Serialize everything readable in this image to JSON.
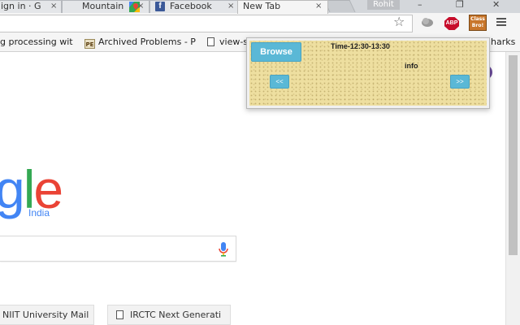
{
  "tabs": [
    {
      "label": "ign in · G",
      "close": "×"
    },
    {
      "label": "Mountain",
      "close": "×"
    },
    {
      "label": "Facebook",
      "close": "×"
    },
    {
      "label": "New Tab",
      "close": "×"
    }
  ],
  "profile": {
    "name": "Rohit"
  },
  "window_controls": {
    "minimize": "–",
    "maximize": "❐",
    "close": "✕"
  },
  "toolbar": {
    "star": "☆",
    "abp": "ABP",
    "ext_label": "Class Bro!"
  },
  "bookmarks": [
    {
      "label": "g processing wit",
      "icon": "none"
    },
    {
      "label": "Archived Problems - P",
      "icon": "pe-icon",
      "icon_text": "PE"
    },
    {
      "label": "view-s",
      "icon": "page-icon"
    },
    {
      "label": "harks",
      "icon": "none"
    }
  ],
  "page": {
    "logo_letters": [
      "g",
      "l",
      "e"
    ],
    "logo_subtitle": "India",
    "tiles": [
      {
        "label": "NIIT University Mail"
      },
      {
        "label": "IRCTC Next Generati"
      }
    ]
  },
  "popup": {
    "browse_label": "Browse",
    "time_label": "Time-12:30-13:30",
    "info_label": "info",
    "prev_label": "<<",
    "next_label": ">>"
  },
  "colors": {
    "popup_bg": "#eedfa0",
    "button": "#5ab8d6",
    "google_blue": "#4285f4",
    "google_green": "#34a853",
    "google_red": "#ea4335"
  }
}
